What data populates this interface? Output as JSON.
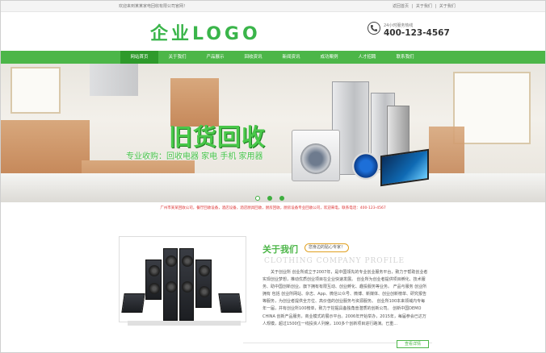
{
  "topbar": {
    "welcome": "欢迎来到某某家电回收有限公司官网！",
    "links": [
      "返回首页",
      "|",
      "关于我们",
      "|",
      "关于我们"
    ]
  },
  "header": {
    "logo": "企业LOGO",
    "hotline_label": "24小时服务热线",
    "hotline_number": "400-123-4567"
  },
  "nav": {
    "items": [
      "网站首页",
      "关于我们",
      "产品展示",
      "回收资讯",
      "新闻资讯",
      "成功案例",
      "人才招聘",
      "联系我们"
    ],
    "active_index": 0
  },
  "banner": {
    "title": "旧货回收",
    "subtitle": "专业收购：回收电器  家电  手机  家用器",
    "slides": 3,
    "active_slide": 0
  },
  "infoline": "广州市某某回收公司，餐厅回收设备，酒店设备，酒店厨具回收，厨房回收，厨房设备专业回收公司，欢迎来电，联系电话：400-123-4567",
  "about": {
    "title": "关于我们",
    "tag": "您身边的贴心专家！",
    "subtitle_en": "CLOTHING COMPANY PROFILE",
    "body": "　　关于创业所 创业所成立于2007年，是中国领先的专业创业服务平台，致力于帮助创业者实现创业梦想，推动优质创业项目在企业快速发展。 创业所为创业者提供项目孵化、技术服务、助中国创新创业。旗下拥有有限互动、创业孵化、趣投服务等业务。 产品与服务 创业所拥有 包括 创业所网站、杂志、App、微信公众号、微博、新媒体、创业创新榜单、研究报告等服务，为创业者提供全方位、高价值的创业服务与资源服务。 创业所100本来领域内专每年一届，并有创业所100榜单，致力于挖掘具备独角兽潜质的创新公司。 创新中国DEMO CHINA 创新产品服务，商业模式的展示平台。2006年开始举办，2015年，每届参会已达万人规模，超过1500位一线投资人列席，100多个创新项目进行路演。已重...",
    "more": "查看详情"
  }
}
